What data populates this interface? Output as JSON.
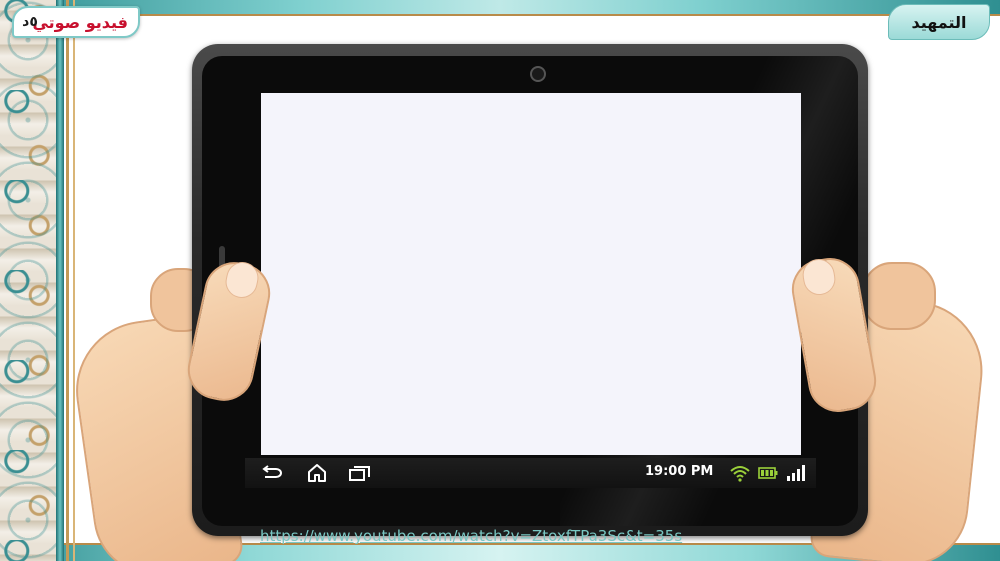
{
  "header": {
    "video_label": "فيديو صوتي",
    "corner_badge": "٥د",
    "tab_label": "التمهيد"
  },
  "tablet": {
    "status_bar": {
      "time": "19:00 PM",
      "icons": [
        "wifi-icon",
        "battery-icon",
        "signal-icon"
      ]
    },
    "nav_icons": [
      "back-icon",
      "home-icon",
      "recent-apps-icon"
    ]
  },
  "footer": {
    "link_text": "https://www.youtube.com/watch?v=ZtoxfTPa3Sc&t=35s"
  },
  "colors": {
    "accent_teal": "#3b8f92",
    "gold": "#c49a57",
    "video_label_red": "#c8102e",
    "link_teal": "#79c7c3",
    "wifi_green": "#9bd13a"
  }
}
